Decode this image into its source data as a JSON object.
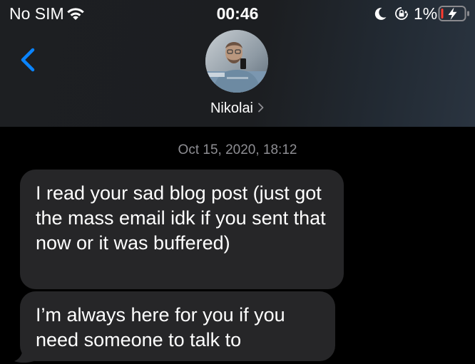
{
  "status_bar": {
    "carrier": "No SIM",
    "time": "00:46",
    "battery_percent": "1%",
    "icons": [
      "wifi-icon",
      "moon-icon",
      "rotation-lock-icon",
      "battery-charging-icon"
    ],
    "battery_level": 0.01,
    "battery_color": "#ff3b30"
  },
  "header": {
    "back_icon": "chevron-left-icon",
    "contact_name": "Nikolai",
    "chevron_icon": "chevron-right-icon",
    "accent_color": "#0a84ff"
  },
  "conversation": {
    "timestamp": "Oct 15, 2020, 18:12",
    "messages": [
      {
        "direction": "incoming",
        "text": "I read your sad blog post (just got the mass email idk if you sent that now or it was buffered)"
      },
      {
        "direction": "incoming",
        "text": "I’m always here for you if you need someone to talk to"
      }
    ],
    "bubble_color": "#262628",
    "timestamp_color": "#8e8e93"
  }
}
